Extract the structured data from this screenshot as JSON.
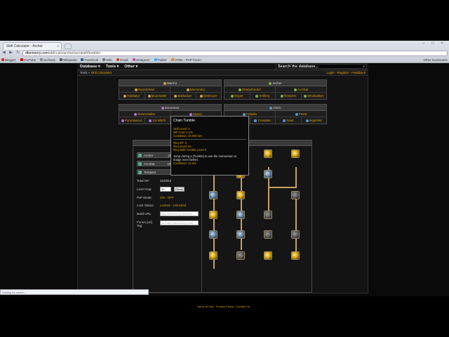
{
  "browser": {
    "tab_title": "Skill Calculator - Archer",
    "tab_close": "x",
    "window_buttons": "– □ ×",
    "back": "◀",
    "forward": "▶",
    "reload": "↻",
    "url_domain": "dbemnory.com",
    "url_rest": "/skill-calc/archer/acrobat/#tumble/",
    "bookmarks": [
      "Blogger",
      "YouTube",
      "archives",
      "Wikipedia",
      "Facebook",
      "Wiki",
      "Gmail",
      "Instagram",
      "Twitter",
      "HTML - PHP forum"
    ],
    "other_bookmarks": "Other bookmarks"
  },
  "site": {
    "nav": [
      "Database ▾",
      "Tools ▾",
      "Other ▾"
    ],
    "search_placeholder": "Search the database...",
    "breadcrumb_root": "Tools »",
    "breadcrumb_current": "Skill Calculator",
    "account_links": "Login - Register - Feedback"
  },
  "classes": [
    {
      "name": "Warrior",
      "color": "#d0a040",
      "adv": [
        "Swordsman",
        "Mercenary"
      ],
      "sub": [
        "Gladiator",
        "Moonsalter",
        "Barbarian",
        "Destroyer"
      ]
    },
    {
      "name": "Archer",
      "color": "#7fb040",
      "adv": [
        "Sharpshooter",
        "Acrobat"
      ],
      "sub": [
        "Sniper",
        "Artillery",
        "Tempest",
        "Windwalker"
      ]
    },
    {
      "name": "Sorceress",
      "color": "#b070d0",
      "adv": [
        "Elementalist",
        "Mystic"
      ],
      "sub": [
        "Pyromancer",
        "Ice Witch",
        "War Mage",
        "Chaos Mage"
      ]
    },
    {
      "name": "Cleric",
      "color": "#4f9ad0",
      "adv": [
        "Paladin",
        "Priest"
      ],
      "sub": [
        "Guardian",
        "Crusader",
        "Saint",
        "Inquisitor"
      ]
    }
  ],
  "tree": {
    "title": "Acrobat Skill Tree",
    "sp_rows": [
      {
        "label": "Archer",
        "value": "119/193 SP"
      },
      {
        "label": "Acrobat",
        "value": "191/193 SP"
      },
      {
        "label": "Tempest",
        "value": "0/103 SP"
      }
    ],
    "total_sp_label": "Total SP:",
    "total_sp_value": "310/310",
    "level_cap_label": "Level Cap:",
    "level_cap_value": "50",
    "reset_label": "Reset",
    "pvp_label": "PvP Mode:",
    "pvp_value": "ON - OFF",
    "lock_label": "Lock Status:",
    "lock_value": "Locked - Unlocked",
    "build_url_label": "Build URL:",
    "build_url_value": "http://dbemnory.com/skill",
    "forum_label": "Forum [url] Tag:",
    "forum_value": "[url=http://dbemnory.com/"
  },
  "tooltip": {
    "title": "Chain Tumble",
    "skill_level": "Skill Level: 4",
    "mp_cost": "MP Cost: 2.1%",
    "cooldown": "Cooldown: 10.000 sec",
    "req_sp": "Req SP: 3",
    "req_level": "Req Level: 51",
    "req_skill": "Req Skill: Tumble Level 2",
    "desc1": "Jump during a [Tumble] to use the momentum to",
    "desc2": "dodge even farther.",
    "desc_cd": "Cooldown: 11 sec"
  },
  "footer": "Terms of Use - Privacy Policy - Contact Us",
  "statusbar": "Waiting for cache..."
}
